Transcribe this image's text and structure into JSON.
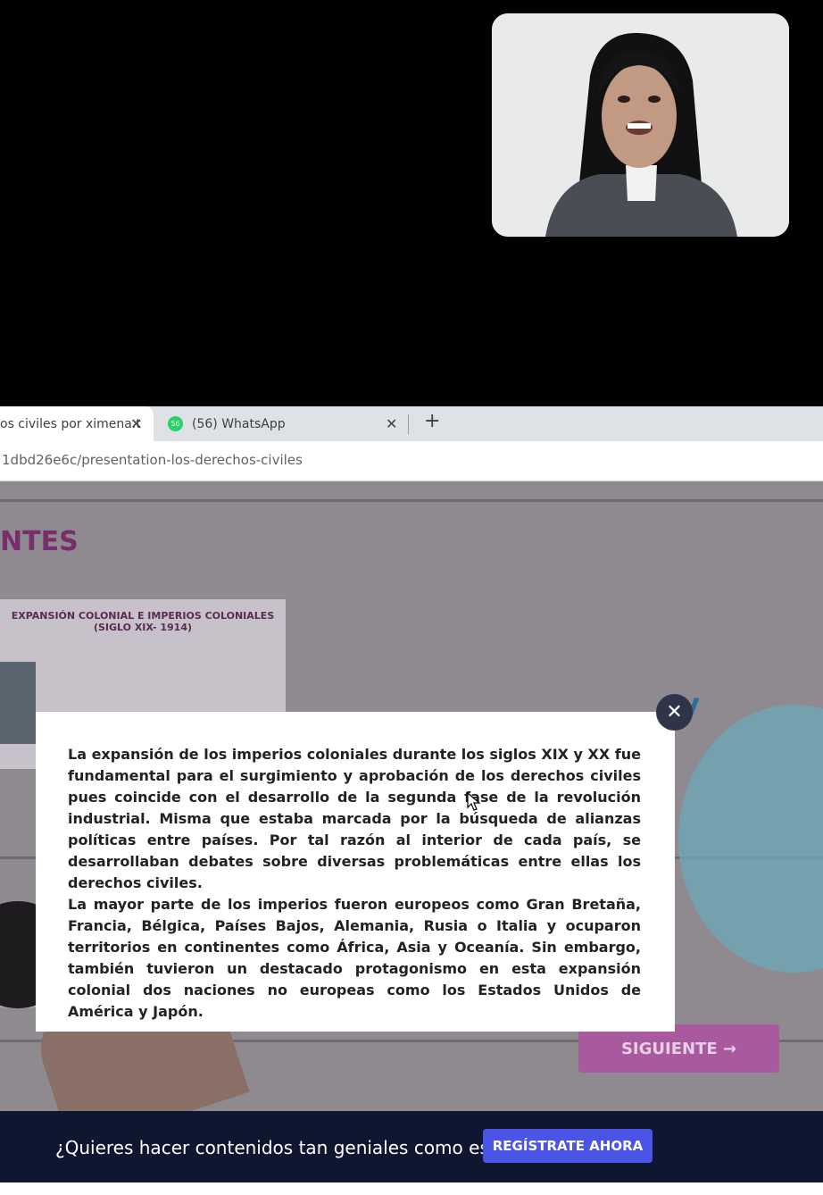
{
  "browser": {
    "tabs": [
      {
        "label": "os civiles por ximena.t",
        "close": "✕"
      },
      {
        "label": "(56) WhatsApp",
        "badge": "56",
        "close": "✕"
      }
    ],
    "new_tab": "+",
    "url": "1dbd26e6c/presentation-los-derechos-civiles"
  },
  "slide": {
    "heading": "NTES",
    "card_title": "EXPANSIÓN COLONIAL E IMPERIOS COLONIALES (SIGLO XIX- 1914)",
    "deco_letter": "y",
    "next_button": "SIGUIENTE →"
  },
  "modal": {
    "close": "✕",
    "paragraphs": [
      "La expansión de los imperios coloniales durante los siglos XIX y XX fue fundamental para el surgimiento y aprobación de los derechos civiles pues coincide con el desarrollo de la segunda fase de la revolución industrial. Misma que estaba marcada por la búsqueda de alianzas políticas entre países. Por tal razón al interior de cada país, se desarrollaban debates sobre diversas problemáticas entre ellas los derechos civiles.",
      "La mayor parte de los imperios fueron europeos como Gran Bretaña, Francia, Bélgica, Países Bajos, Alemania, Rusia o Italia y ocuparon territorios en continentes como África, Asia y Oceanía. Sin embargo, también tuvieron un destacado protagonismo en esta expansión colonial dos naciones no europeas como los Estados Unidos de América y Japón."
    ]
  },
  "footer": {
    "text": "¿Quieres hacer contenidos tan geniales como este?",
    "register_button": "REGÍSTRATE AHORA"
  },
  "colors": {
    "accent": "#4a55e8",
    "whatsapp_green": "#25d366",
    "heading_purple": "#7a2d6d",
    "footer_bg": "#0e1630"
  },
  "icons": [
    "close-icon",
    "whatsapp-icon",
    "plus-icon",
    "cursor-icon",
    "arrow-right-icon"
  ]
}
